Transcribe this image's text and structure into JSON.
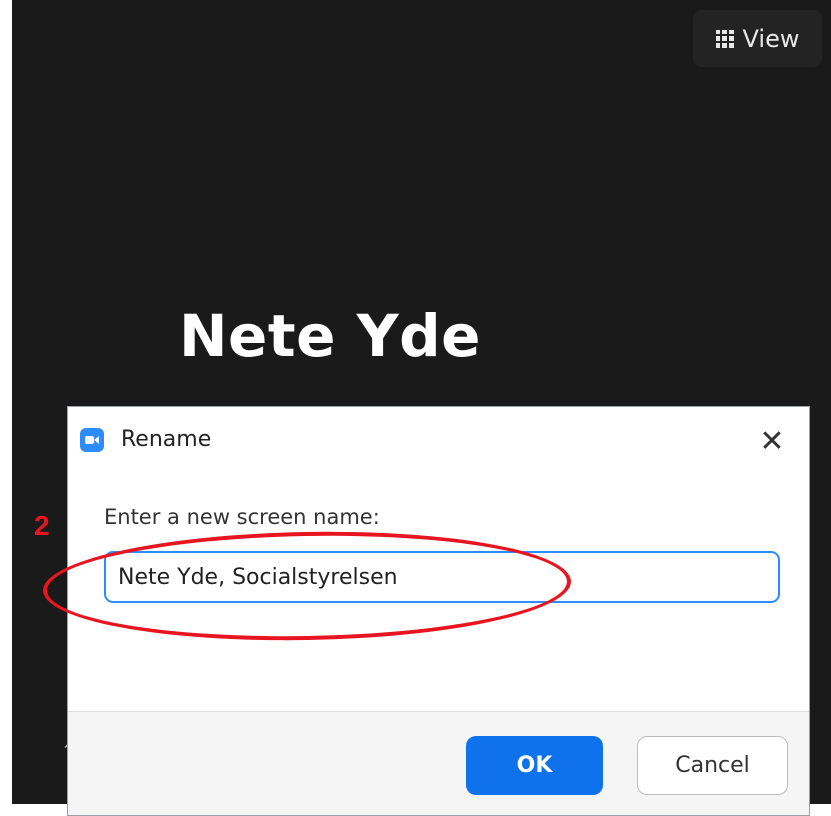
{
  "toolbar": {
    "view_label": "View",
    "view_icon": "grid-icon"
  },
  "participant": {
    "name": "Nete Yde"
  },
  "dialog": {
    "title": "Rename",
    "app_icon": "zoom-video-icon",
    "close_icon": "close-icon",
    "close_glyph": "✕",
    "prompt": "Enter a new screen name:",
    "input_value": "Nete Yde, Socialstyrelsen",
    "ok_label": "OK",
    "cancel_label": "Cancel"
  },
  "annotation": {
    "step_number": "2",
    "color": "#e8141f"
  },
  "colors": {
    "accent": "#0e72ed",
    "input_border": "#2d8cff",
    "background": "#1a1a1a"
  }
}
